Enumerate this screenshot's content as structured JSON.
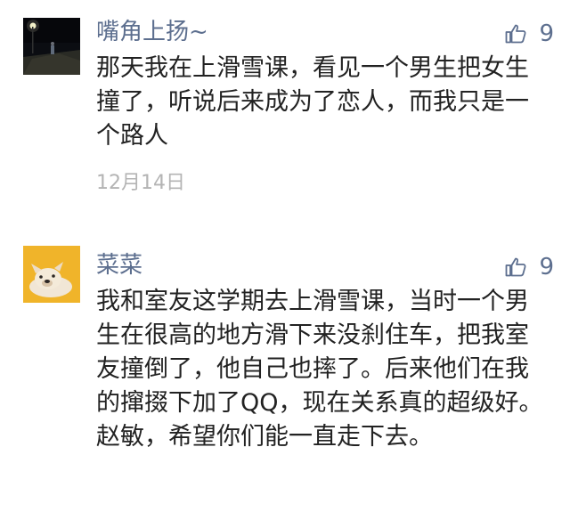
{
  "comments": [
    {
      "username": "嘴角上扬~",
      "text": "那天我在上滑雪课，看见一个男生把女生撞了，听说后来成为了恋人，而我只是一个路人",
      "date": "12月14日",
      "likes": "9",
      "avatar_icon": "night-court-photo-avatar"
    },
    {
      "username": "菜菜",
      "text": "我和室友这学期去上滑雪课，当时一个男生在很高的地方滑下来没刹住车，把我室友撞倒了，他自己也摔了。后来他们在我的撺掇下加了QQ，现在关系真的超级好。赵敏，希望你们能一直走下去。",
      "likes": "9",
      "avatar_icon": "bulldog-photo-avatar"
    }
  ],
  "colors": {
    "username": "#5d6f8f",
    "text": "#222222",
    "date": "#b4b4b4",
    "like_icon": "#5d6f8f"
  },
  "icons": {
    "like": "thumbs-up-icon"
  }
}
